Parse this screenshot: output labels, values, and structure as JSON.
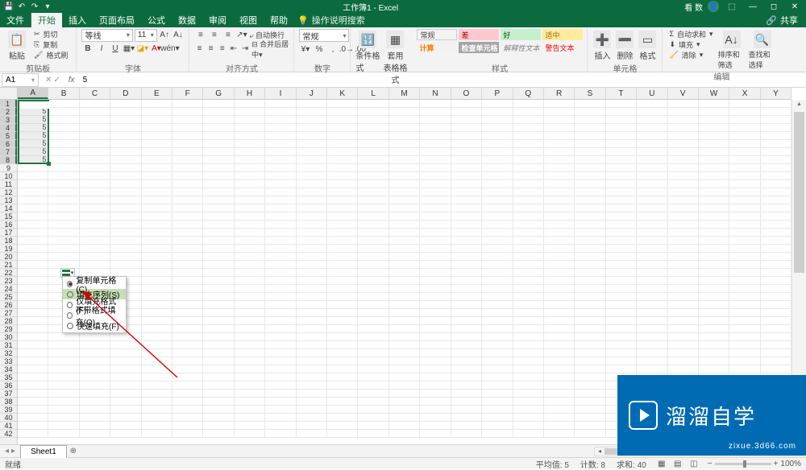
{
  "titlebar": {
    "title": "工作簿1 - Excel",
    "user": "看 数"
  },
  "menubar": {
    "file": "文件",
    "tabs": [
      "开始",
      "插入",
      "页面布局",
      "公式",
      "数据",
      "审阅",
      "视图",
      "帮助"
    ],
    "active_index": 0,
    "search_placeholder": "操作说明搜索",
    "share": "共享"
  },
  "ribbon": {
    "clipboard": {
      "paste": "粘贴",
      "cut": "剪切",
      "copy": "复制",
      "format_painter": "格式刷",
      "label": "剪贴板"
    },
    "font": {
      "name": "等线",
      "size": "11",
      "label": "字体"
    },
    "alignment": {
      "wrap": "自动换行",
      "merge": "合并后居中",
      "label": "对齐方式"
    },
    "number": {
      "format": "常规",
      "label": "数字"
    },
    "cond": {
      "cond_format": "条件格式",
      "table_format": "套用\n表格格式"
    },
    "styles": {
      "row1": [
        "常规",
        "差",
        "好",
        "适中"
      ],
      "row2": [
        "计算",
        "检查单元格",
        "解释性文本",
        "警告文本"
      ],
      "label": "样式"
    },
    "cells": {
      "insert": "插入",
      "delete": "删除",
      "format": "格式",
      "label": "单元格"
    },
    "editing": {
      "sum": "自动求和",
      "fill": "填充",
      "clear": "清除",
      "sort": "排序和筛选",
      "find": "查找和选择",
      "label": "编辑"
    }
  },
  "fbar": {
    "ref": "A1",
    "value": "5"
  },
  "grid": {
    "cols": [
      "A",
      "B",
      "C",
      "D",
      "E",
      "F",
      "G",
      "H",
      "I",
      "J",
      "K",
      "L",
      "M",
      "N",
      "O",
      "P",
      "Q",
      "R",
      "S",
      "T",
      "U",
      "V",
      "W",
      "X",
      "Y"
    ],
    "rows": 42,
    "sel_rows": 8,
    "values": [
      "5",
      "5",
      "5",
      "5",
      "5",
      "5",
      "5",
      "5"
    ]
  },
  "autofill": {
    "options": [
      {
        "label": "复制单元格(C)",
        "checked": true,
        "hover": false
      },
      {
        "label": "填充序列(S)",
        "checked": false,
        "hover": true
      },
      {
        "label": "仅填充格式(F)",
        "checked": false,
        "hover": false
      },
      {
        "label": "不带格式填充(O)",
        "checked": false,
        "hover": false
      },
      {
        "label": "快速填充(F)",
        "checked": false,
        "hover": false
      }
    ]
  },
  "sheet": {
    "name": "Sheet1"
  },
  "status": {
    "ready": "就绪",
    "avg": "平均值: 5",
    "count": "计数: 8",
    "sum": "求和: 40",
    "zoom": "100%"
  },
  "watermark": {
    "text": "溜溜自学",
    "sub": "zixue.3d66.com"
  }
}
